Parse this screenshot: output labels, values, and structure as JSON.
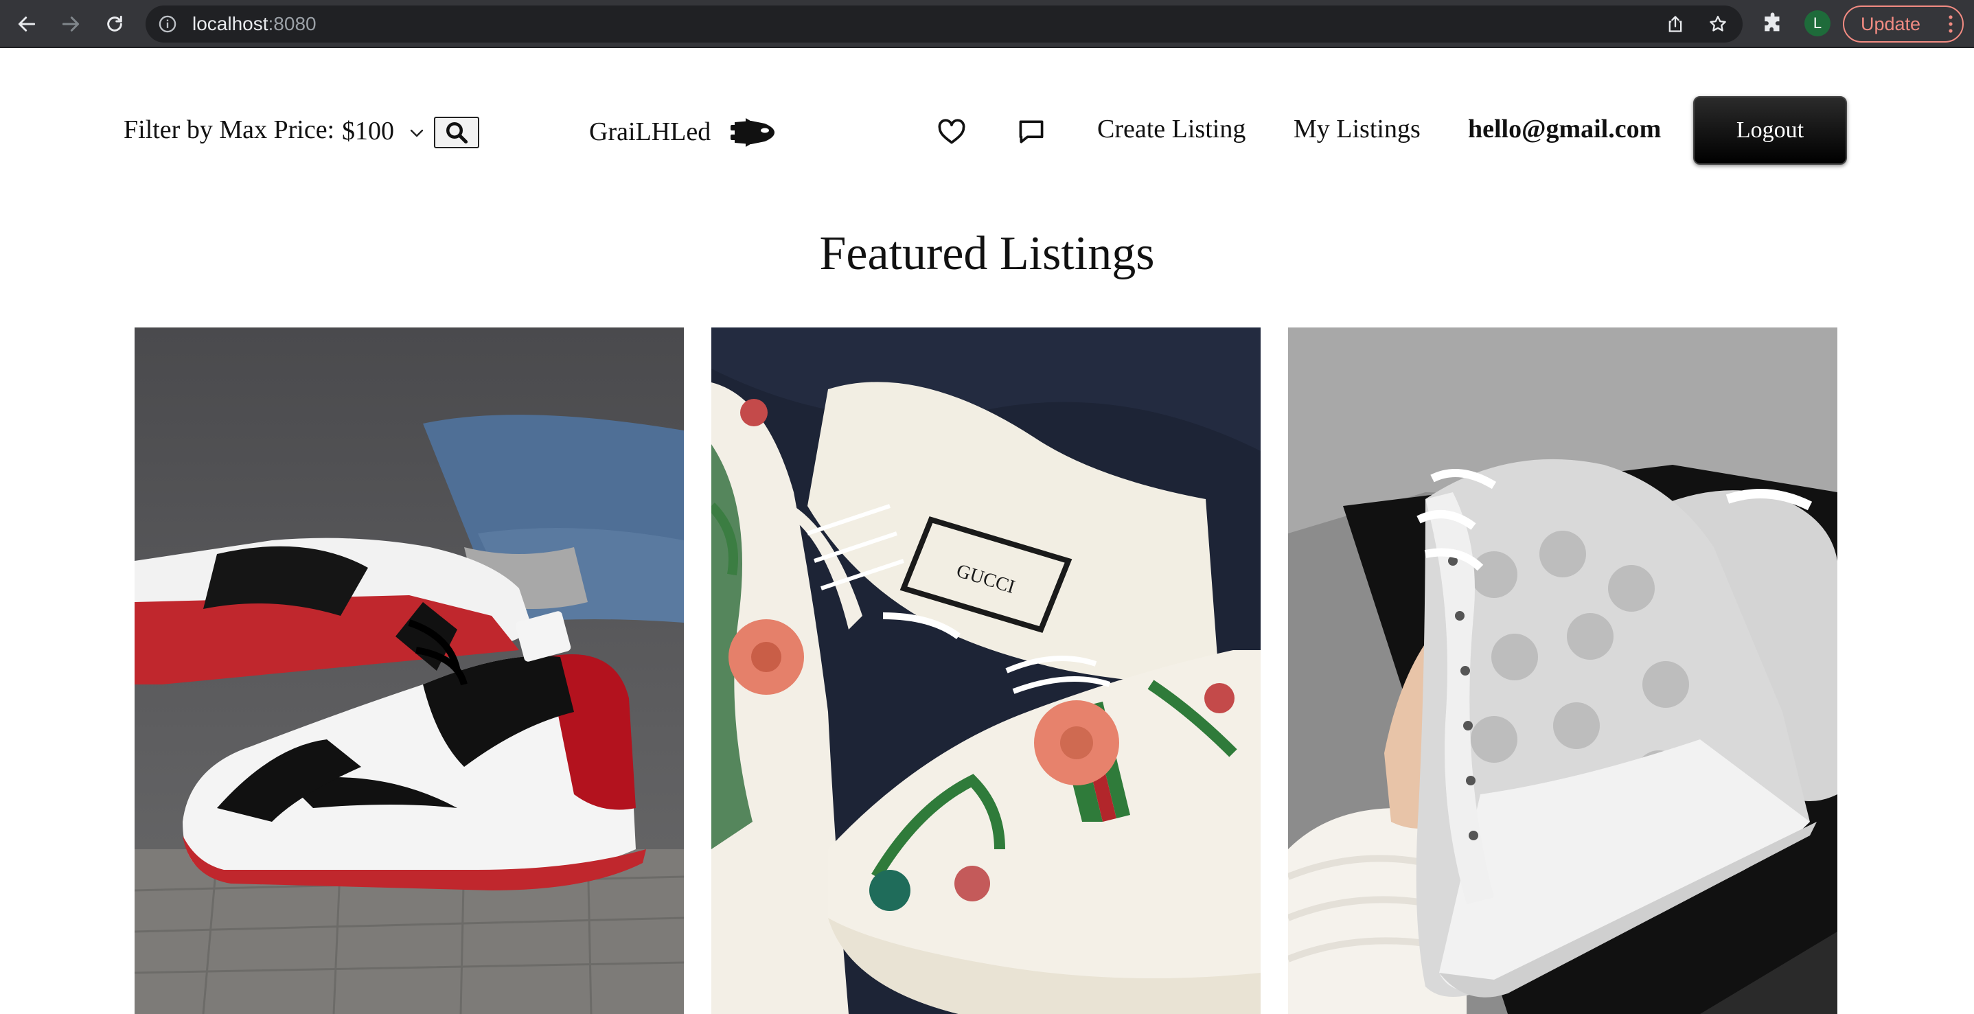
{
  "browser": {
    "url_host": "localhost",
    "url_port": ":8080",
    "profile_initial": "L",
    "update_label": "Update"
  },
  "header": {
    "filter_label": "Filter by Max Price:",
    "max_price_selected": "$100",
    "brand_name": "GraiLHLed",
    "nav": {
      "create_listing": "Create Listing",
      "my_listings": "My Listings",
      "user_email": "hello@gmail.com",
      "logout_label": "Logout"
    }
  },
  "main": {
    "title": "Featured Listings",
    "listings": [
      {
        "image_desc": "red-black-white-high-top-sneaker"
      },
      {
        "image_desc": "floral-embroidered-sneakers-with-dust-bag",
        "bag_label": "GUCCI"
      },
      {
        "image_desc": "grey-monogram-high-top-sneakers"
      }
    ]
  },
  "colors": {
    "chrome_bg": "#35363a",
    "omnibox_bg": "#202124",
    "update_accent": "#f28b82",
    "logout_bg": "#000000"
  }
}
